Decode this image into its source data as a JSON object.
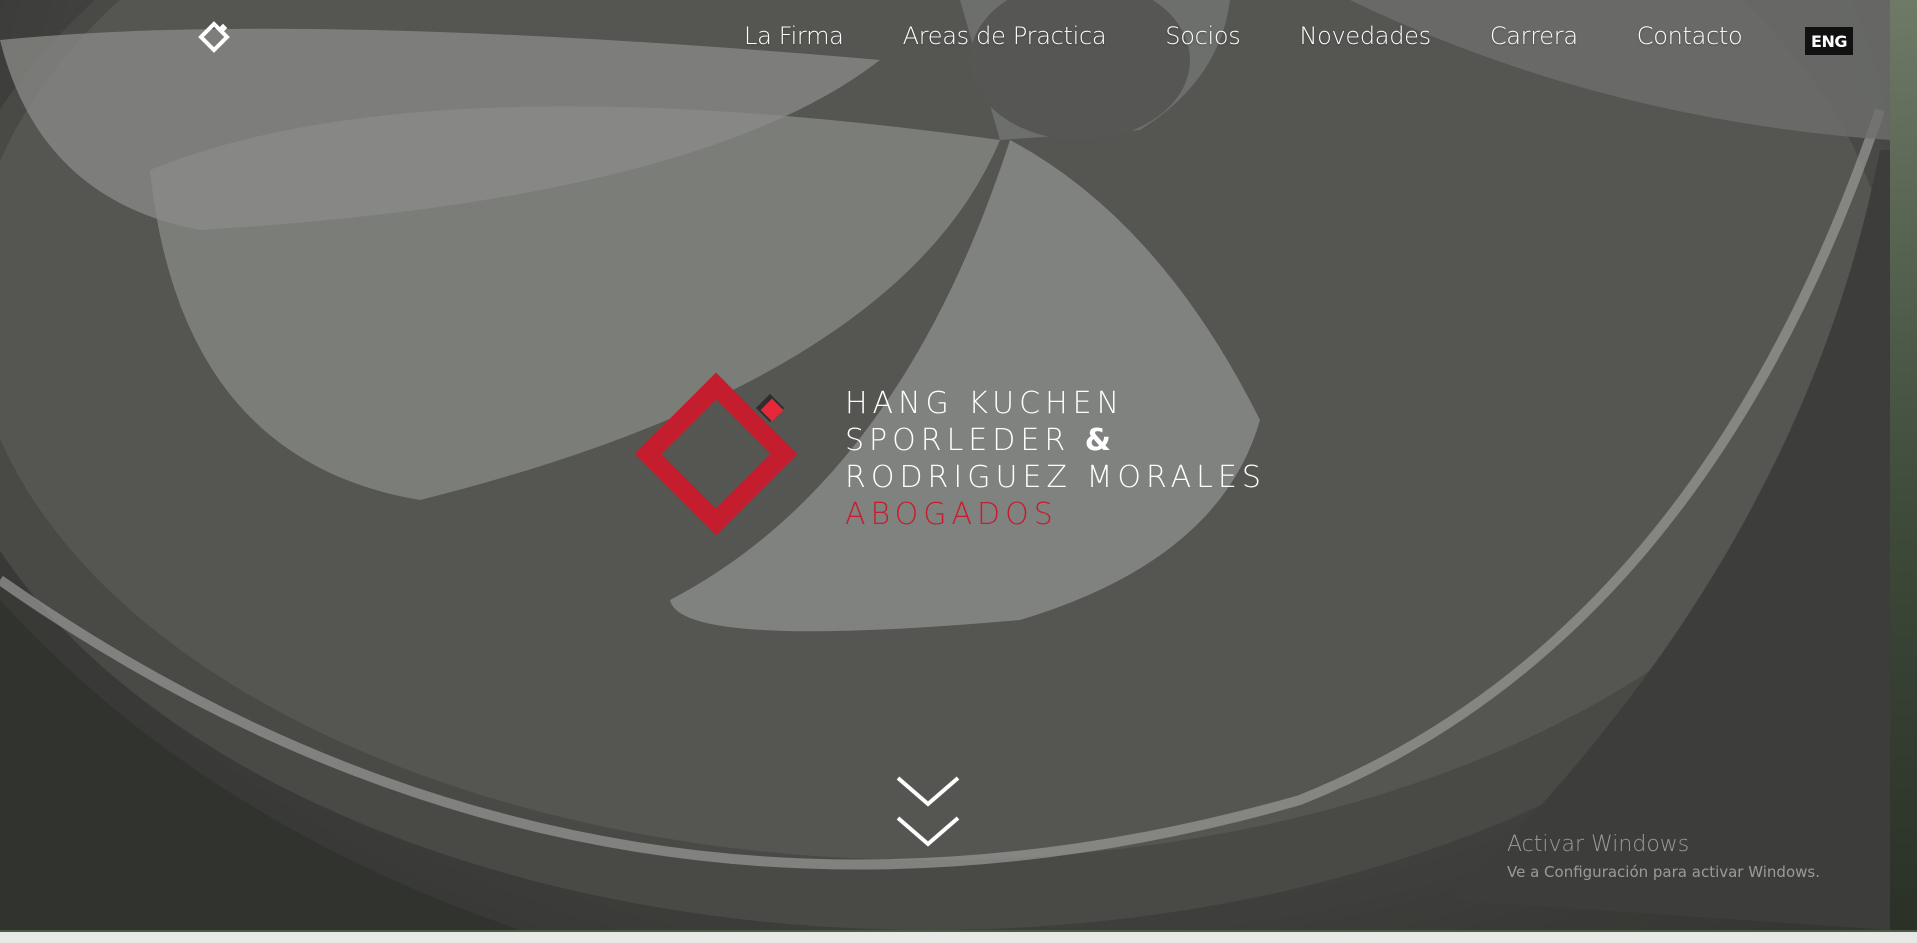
{
  "nav": {
    "items": [
      {
        "label": "La Firma"
      },
      {
        "label": "Areas de Practica"
      },
      {
        "label": "Socios"
      },
      {
        "label": "Novedades"
      },
      {
        "label": "Carrera"
      },
      {
        "label": "Contacto"
      }
    ],
    "language_label": "ENG"
  },
  "brand": {
    "line1": "HANG KUCHEN",
    "line2": "SPORLEDER",
    "ampersand": "&",
    "line3": "RODRIGUEZ MORALES",
    "line4": "ABOGADOS",
    "accent_color": "#c41e2e"
  },
  "icons": {
    "nav_logo": "diamond-logo-icon",
    "main_logo": "diamond-logo-icon",
    "scroll": "double-chevron-down-icon"
  },
  "watermark": {
    "title": "Activar Windows",
    "subtitle": "Ve a Configuración para activar Windows."
  }
}
